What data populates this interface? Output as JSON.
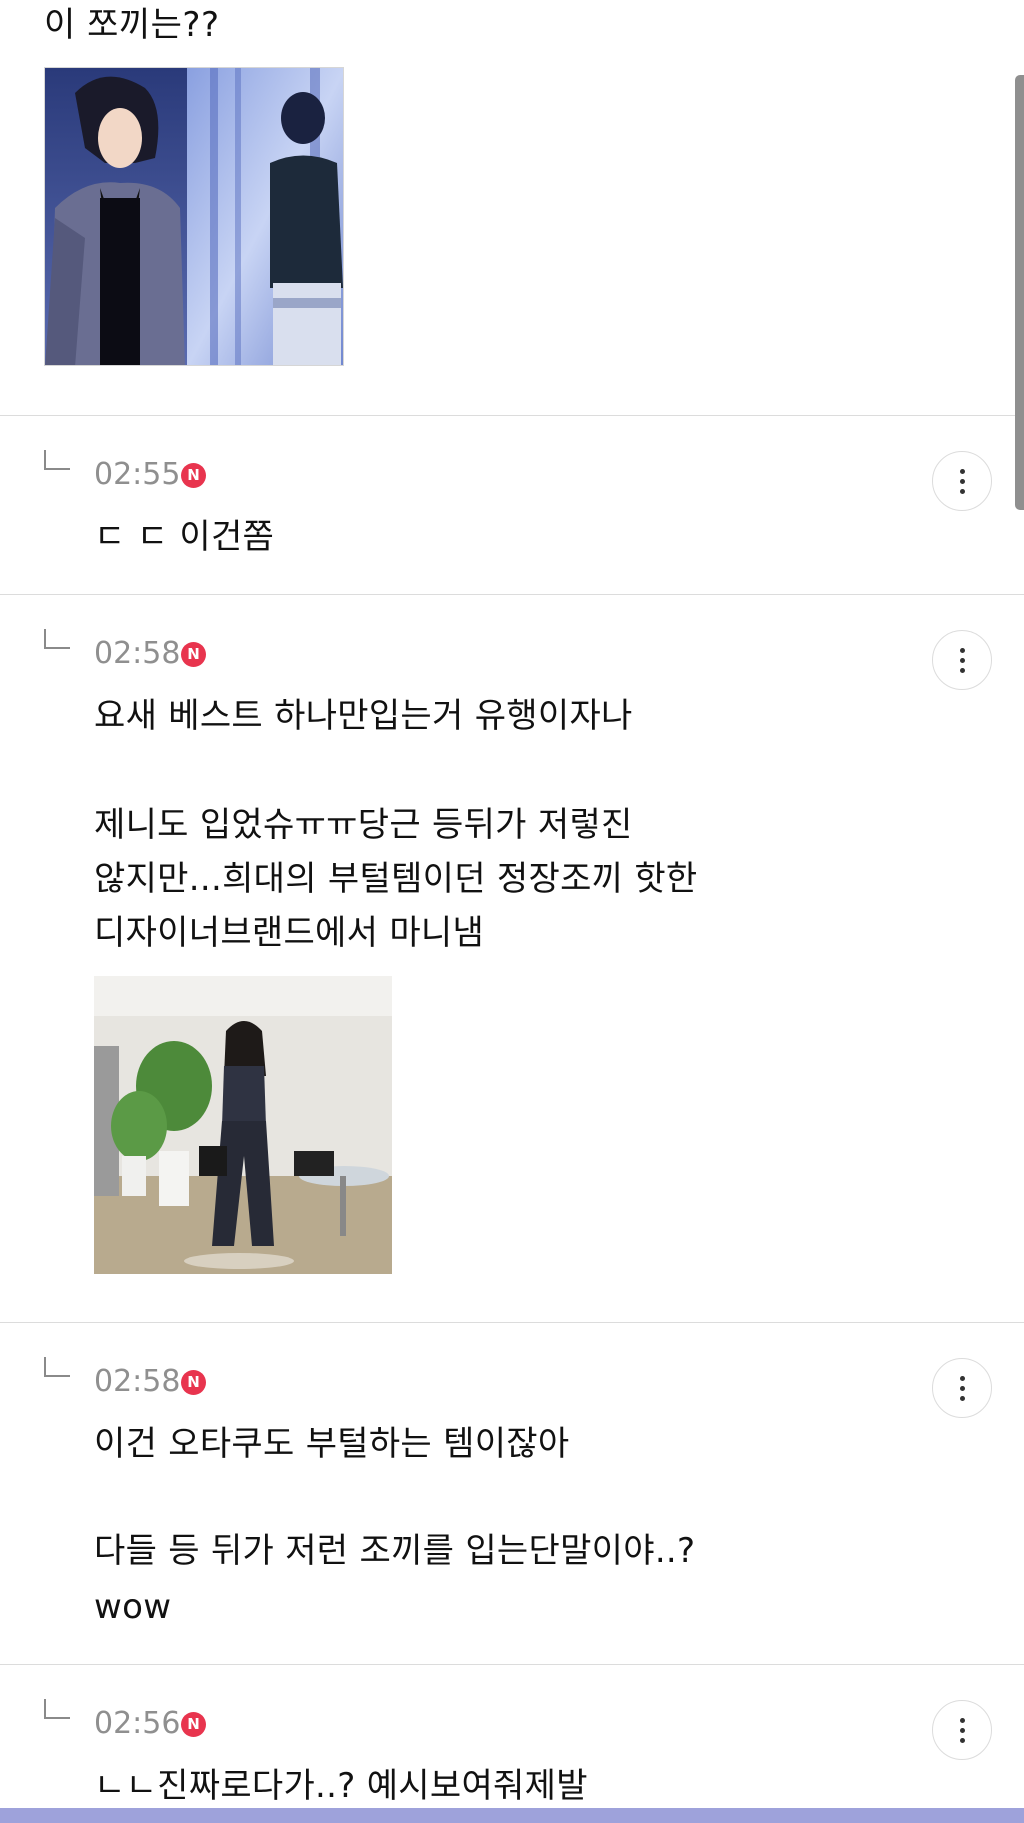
{
  "top_comment": {
    "text": "이 쪼끼는??"
  },
  "replies": [
    {
      "time": "02:55",
      "badge": "N",
      "lines": [
        "ㄷ ㄷ 이건쫌"
      ]
    },
    {
      "time": "02:58",
      "badge": "N",
      "lines": [
        "요새 베스트 하나만입는거 유행이자나",
        "",
        "제니도 입었슈ㅠㅠ당근 등뒤가 저렇진",
        "않지만...희대의 부털템이던 정장조끼 핫한",
        "디자이너브랜드에서 마니냄"
      ]
    },
    {
      "time": "02:58",
      "badge": "N",
      "lines": [
        "이건 오타쿠도 부털하는 템이잖아",
        "",
        "다들 등 뒤가 저런 조끼를 입는단말이야..?",
        "wow"
      ]
    },
    {
      "time": "02:56",
      "badge": "N",
      "lines": [
        "ㄴㄴ진짜로다가..? 예시보여줘제발"
      ]
    }
  ],
  "icons": {
    "reply": "reply-arrow-icon",
    "more": "more-vertical-icon",
    "new_badge": "new-badge-icon"
  },
  "colors": {
    "badge": "#e8344e",
    "timestamp": "#8f8f8f",
    "divider": "#dcdcdc",
    "bottom_bar": "#9ea2db"
  }
}
